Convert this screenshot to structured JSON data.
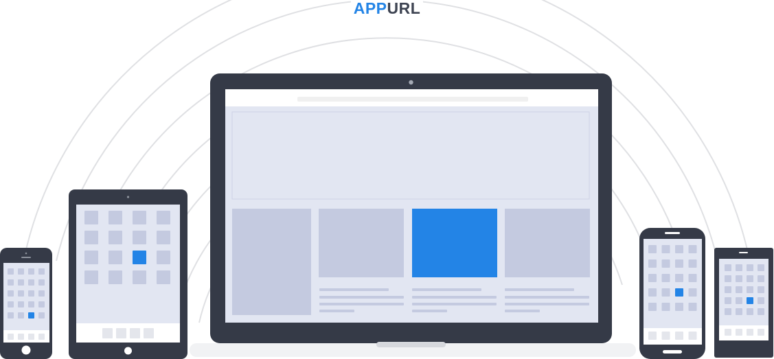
{
  "logo": {
    "part1": "APP",
    "part2": "URL"
  },
  "colors": {
    "accent": "#2384e6",
    "device_frame": "#353a47",
    "screen_bg": "#e2e6f2",
    "placeholder": "#c4cae0",
    "arc": "#dfe0e3",
    "bar": "#f2f2f2",
    "logo_dark": "#3d4351"
  },
  "devices": [
    {
      "name": "iphone",
      "icons": {
        "columns": 4,
        "rows": 5,
        "highlighted": [
          4,
          2
        ]
      },
      "dock_items": 4
    },
    {
      "name": "ipad",
      "icons": {
        "columns": 4,
        "rows": 4,
        "highlighted": [
          2,
          2
        ]
      },
      "dock_items": 4
    },
    {
      "name": "laptop",
      "content_cards": 3,
      "highlighted_card": 2
    },
    {
      "name": "android-phone",
      "icons": {
        "columns": 4,
        "rows": 5,
        "highlighted": [
          3,
          2
        ]
      },
      "dock_items": 4
    },
    {
      "name": "android-small",
      "icons": {
        "columns": 4,
        "rows": 5,
        "highlighted": [
          3,
          2
        ]
      },
      "dock_items": 4
    }
  ]
}
